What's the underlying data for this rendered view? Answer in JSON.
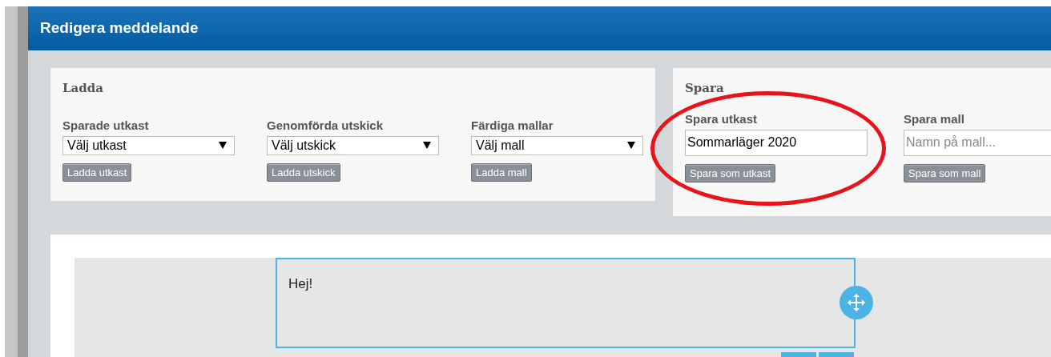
{
  "header": {
    "title": "Redigera meddelande"
  },
  "load_panel": {
    "title": "Ladda",
    "groups": [
      {
        "label": "Sparade utkast",
        "select": "Välj utkast",
        "button": "Ladda utkast"
      },
      {
        "label": "Genomförda utskick",
        "select": "Välj utskick",
        "button": "Ladda utskick"
      },
      {
        "label": "Färdiga mallar",
        "select": "Välj mall",
        "button": "Ladda mall"
      }
    ]
  },
  "save_panel": {
    "title": "Spara",
    "groups": [
      {
        "label": "Spara utkast",
        "value": "Sommarläger 2020",
        "button": "Spara som utkast"
      },
      {
        "label": "Spara mall",
        "placeholder": "Namn på mall...",
        "button": "Spara som mall"
      }
    ]
  },
  "editor": {
    "text": "Hej!"
  }
}
